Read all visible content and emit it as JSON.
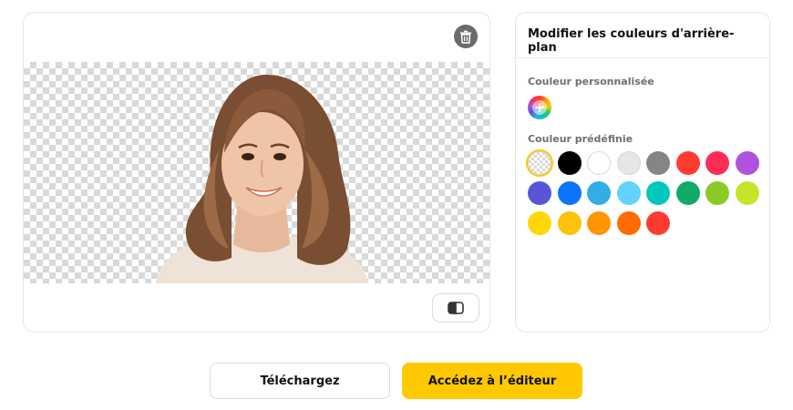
{
  "preview": {
    "delete_icon": "trash-icon",
    "compare_icon": "compare-split-icon",
    "image_alt": "Portrait with background removed"
  },
  "panel": {
    "title": "Modifier les couleurs d'arrière-plan",
    "custom_label": "Couleur personnalisée",
    "custom_icon": "plus-icon",
    "preset_label": "Couleur prédéfinie",
    "presets": [
      {
        "name": "transparent",
        "hex": "transparent",
        "selected": true
      },
      {
        "name": "black",
        "hex": "#000000"
      },
      {
        "name": "white",
        "hex": "#ffffff"
      },
      {
        "name": "light-gray",
        "hex": "#e6e6e6"
      },
      {
        "name": "gray",
        "hex": "#858585"
      },
      {
        "name": "red",
        "hex": "#ff3b30"
      },
      {
        "name": "pink-red",
        "hex": "#ff2d55"
      },
      {
        "name": "purple",
        "hex": "#af52de"
      },
      {
        "name": "indigo",
        "hex": "#5856d6"
      },
      {
        "name": "blue",
        "hex": "#0a74ff"
      },
      {
        "name": "sky-blue",
        "hex": "#32ade6"
      },
      {
        "name": "light-blue",
        "hex": "#64d2ff"
      },
      {
        "name": "teal",
        "hex": "#00c7be"
      },
      {
        "name": "green",
        "hex": "#11aa66"
      },
      {
        "name": "lime-green",
        "hex": "#8ac926"
      },
      {
        "name": "yellow-green",
        "hex": "#c4e52a"
      },
      {
        "name": "yellow",
        "hex": "#ffd60a"
      },
      {
        "name": "amber",
        "hex": "#ffc20a"
      },
      {
        "name": "orange",
        "hex": "#ff9500"
      },
      {
        "name": "deep-orange",
        "hex": "#ff6b00"
      },
      {
        "name": "red-2",
        "hex": "#ff3b30"
      }
    ]
  },
  "actions": {
    "download_label": "Téléchargez",
    "editor_label": "Accédez à l’éditeur"
  },
  "colors": {
    "accent": "#ffc800",
    "border": "#e6e6e6"
  }
}
